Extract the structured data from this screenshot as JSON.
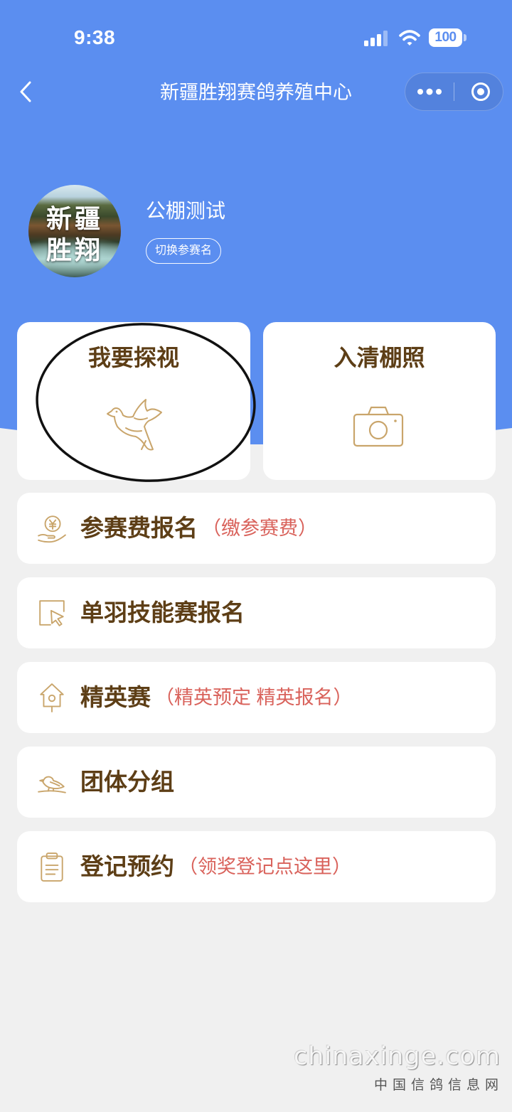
{
  "status_bar": {
    "time": "9:38",
    "battery_level": "100",
    "icons": [
      "signal-icon",
      "wifi-icon",
      "battery-icon"
    ]
  },
  "nav": {
    "title": "新疆胜翔赛鸽养殖中心",
    "back_icon": "chevron-left-icon",
    "capsule_icons": [
      "more-dots-icon",
      "target-circle-icon"
    ]
  },
  "profile": {
    "avatar_logo_line1": "新疆",
    "avatar_logo_line2": "胜翔",
    "name": "公棚测试",
    "switch_button": "切换参赛名"
  },
  "cards": [
    {
      "label": "我要探视",
      "icon": "dove-icon"
    },
    {
      "label": "入清棚照",
      "icon": "camera-icon"
    }
  ],
  "menu": [
    {
      "label": "参赛费报名",
      "note": "（缴参赛费）",
      "icon": "yen-hand-icon"
    },
    {
      "label": "单羽技能赛报名",
      "icon": "cursor-box-icon"
    },
    {
      "label": "精英赛",
      "note": "（精英预定 精英报名）",
      "icon": "birdhouse-icon"
    },
    {
      "label": "团体分组",
      "icon": "bird-perch-icon"
    },
    {
      "label": "登记预约",
      "note": "（领奖登记点这里）",
      "icon": "clipboard-icon"
    }
  ],
  "watermark": {
    "domain": "chinaxinge.com",
    "site_name": "中国信鸽信息网"
  },
  "colors": {
    "header_blue": "#5b8ef0",
    "page_bg": "#f0f0f0",
    "label_brown": "#5d3e16",
    "note_red": "#d9625b",
    "icon_gold": "#c9a56b",
    "annotation_black": "#111111"
  }
}
